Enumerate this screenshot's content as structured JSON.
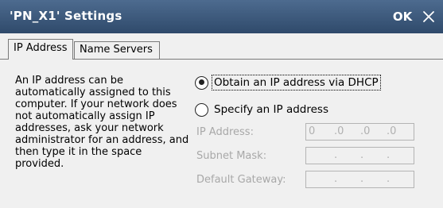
{
  "window": {
    "title": "'PN_X1' Settings",
    "ok_label": "OK"
  },
  "tabs": [
    {
      "label": "IP Address",
      "active": true
    },
    {
      "label": "Name Servers",
      "active": false
    }
  ],
  "description": "An IP address can be automatically assigned to this computer.  If your network does not automatically assign IP addresses, ask your network administrator for an address, and then type it in the space provided.",
  "radios": {
    "dhcp": {
      "label": "Obtain an IP address via DHCP",
      "selected": true
    },
    "static": {
      "label": "Specify an IP address",
      "selected": false
    }
  },
  "fields": {
    "ip_address": {
      "label": "IP Address:",
      "octets": [
        "0",
        ".0",
        ".0",
        ".0"
      ]
    },
    "subnet_mask": {
      "label": "Subnet Mask:",
      "octets": [
        "",
        ".",
        ".",
        "."
      ]
    },
    "default_gateway": {
      "label": "Default Gateway:",
      "octets": [
        "",
        ".",
        ".",
        "."
      ]
    }
  },
  "icons": {
    "close": "close-icon"
  }
}
